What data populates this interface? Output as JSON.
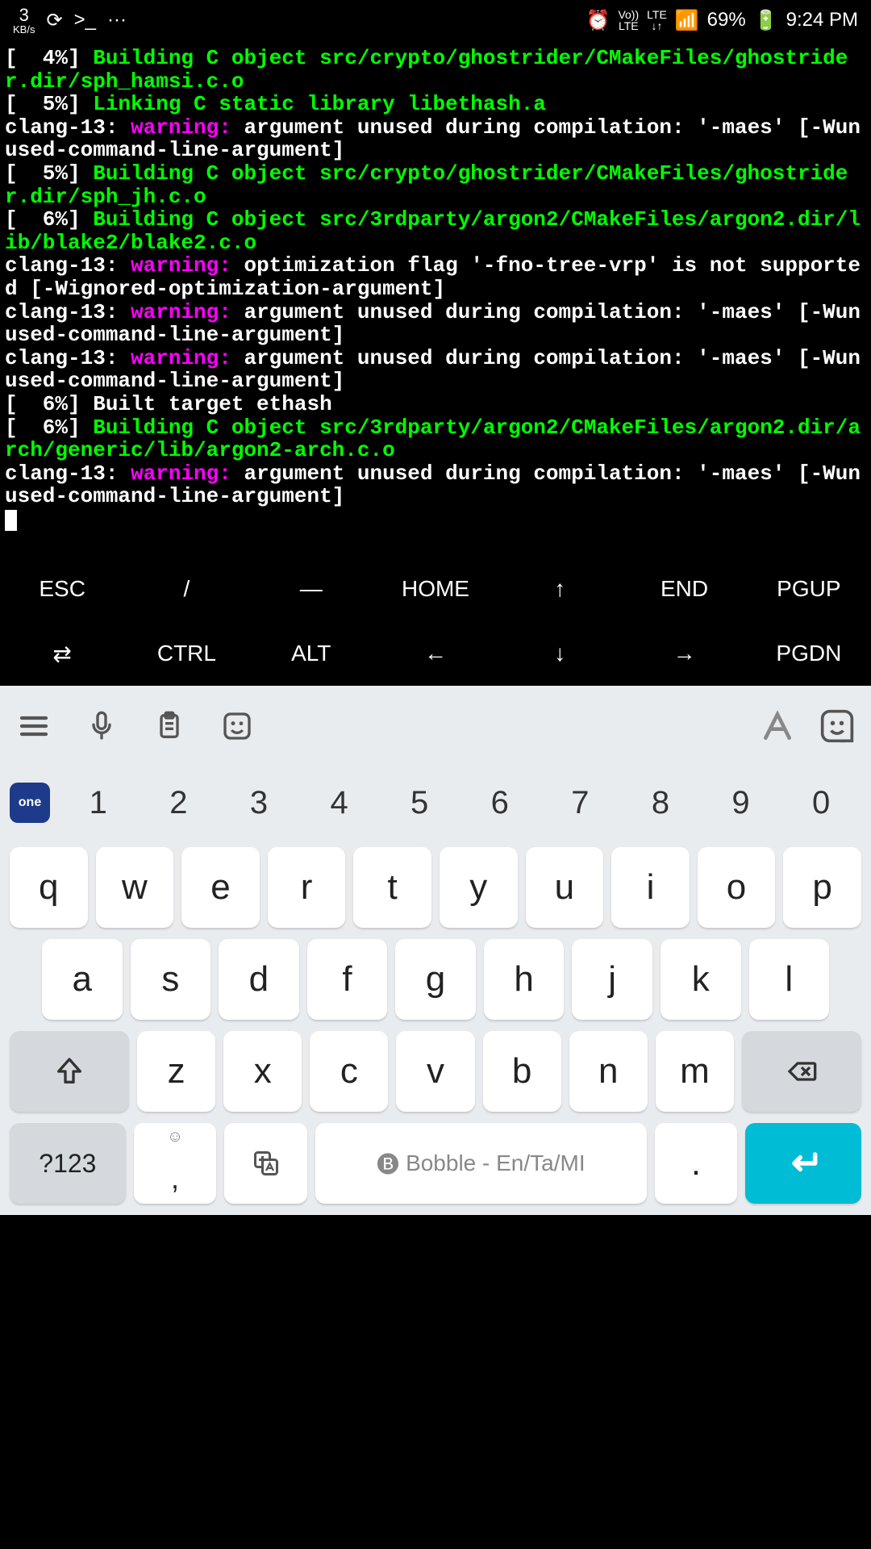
{
  "status": {
    "kbs_num": "3",
    "kbs_label": "KB/s",
    "prompt": ">_",
    "dots": "···",
    "volte_top": "Vo))",
    "volte_bot": "LTE",
    "lte": "LTE",
    "battery": "69%",
    "time": "9:24 PM"
  },
  "terminal_lines": [
    {
      "segments": [
        {
          "c": "white",
          "t": "[  4%] "
        },
        {
          "c": "green",
          "t": "Building C object src/crypto/ghostrider/CMakeFiles/ghostrider.dir/sph_hamsi.c.o"
        }
      ]
    },
    {
      "segments": [
        {
          "c": "white",
          "t": "[  5%] "
        },
        {
          "c": "green",
          "t": "Linking C static library libethash.a"
        }
      ]
    },
    {
      "segments": [
        {
          "c": "white",
          "t": "clang-13: "
        },
        {
          "c": "magenta",
          "t": "warning: "
        },
        {
          "c": "white",
          "t": "argument unused during compilation: '-maes' [-Wunused-command-line-argument]"
        }
      ]
    },
    {
      "segments": [
        {
          "c": "white",
          "t": "[  5%] "
        },
        {
          "c": "green",
          "t": "Building C object src/crypto/ghostrider/CMakeFiles/ghostrider.dir/sph_jh.c.o"
        }
      ]
    },
    {
      "segments": [
        {
          "c": "white",
          "t": "[  6%] "
        },
        {
          "c": "green",
          "t": "Building C object src/3rdparty/argon2/CMakeFiles/argon2.dir/lib/blake2/blake2.c.o"
        }
      ]
    },
    {
      "segments": [
        {
          "c": "white",
          "t": "clang-13: "
        },
        {
          "c": "magenta",
          "t": "warning: "
        },
        {
          "c": "white",
          "t": "optimization flag '-fno-tree-vrp' is not supported [-Wignored-optimization-argument]"
        }
      ]
    },
    {
      "segments": [
        {
          "c": "white",
          "t": "clang-13: "
        },
        {
          "c": "magenta",
          "t": "warning: "
        },
        {
          "c": "white",
          "t": "argument unused during compilation: '-maes' [-Wunused-command-line-argument]"
        }
      ]
    },
    {
      "segments": [
        {
          "c": "white",
          "t": "clang-13: "
        },
        {
          "c": "magenta",
          "t": "warning: "
        },
        {
          "c": "white",
          "t": "argument unused during compilation: '-maes' [-Wunused-command-line-argument]"
        }
      ]
    },
    {
      "segments": [
        {
          "c": "white",
          "t": "[  6%] Built target ethash"
        }
      ]
    },
    {
      "segments": [
        {
          "c": "white",
          "t": "[  6%] "
        },
        {
          "c": "green",
          "t": "Building C object src/3rdparty/argon2/CMakeFiles/argon2.dir/arch/generic/lib/argon2-arch.c.o"
        }
      ]
    },
    {
      "segments": [
        {
          "c": "white",
          "t": "clang-13: "
        },
        {
          "c": "magenta",
          "t": "warning: "
        },
        {
          "c": "white",
          "t": "argument unused during compilation: '-maes' [-Wunused-command-line-argument]"
        }
      ]
    }
  ],
  "extra_keys": {
    "row1": [
      "ESC",
      "/",
      "―",
      "HOME",
      "↑",
      "END",
      "PGUP"
    ],
    "row2": [
      "⇄",
      "CTRL",
      "ALT",
      "←",
      "↓",
      "→",
      "PGDN"
    ]
  },
  "numbers": [
    "1",
    "2",
    "3",
    "4",
    "5",
    "6",
    "7",
    "8",
    "9",
    "0"
  ],
  "letters": {
    "row1": [
      "q",
      "w",
      "e",
      "r",
      "t",
      "y",
      "u",
      "i",
      "o",
      "p"
    ],
    "row2": [
      "a",
      "s",
      "d",
      "f",
      "g",
      "h",
      "j",
      "k",
      "l"
    ],
    "row3": [
      "z",
      "x",
      "c",
      "v",
      "b",
      "n",
      "m"
    ]
  },
  "bottom": {
    "symbols": "?123",
    "space_label": "Bobble - En/Ta/MI",
    "period": ".",
    "one_badge": "one"
  }
}
